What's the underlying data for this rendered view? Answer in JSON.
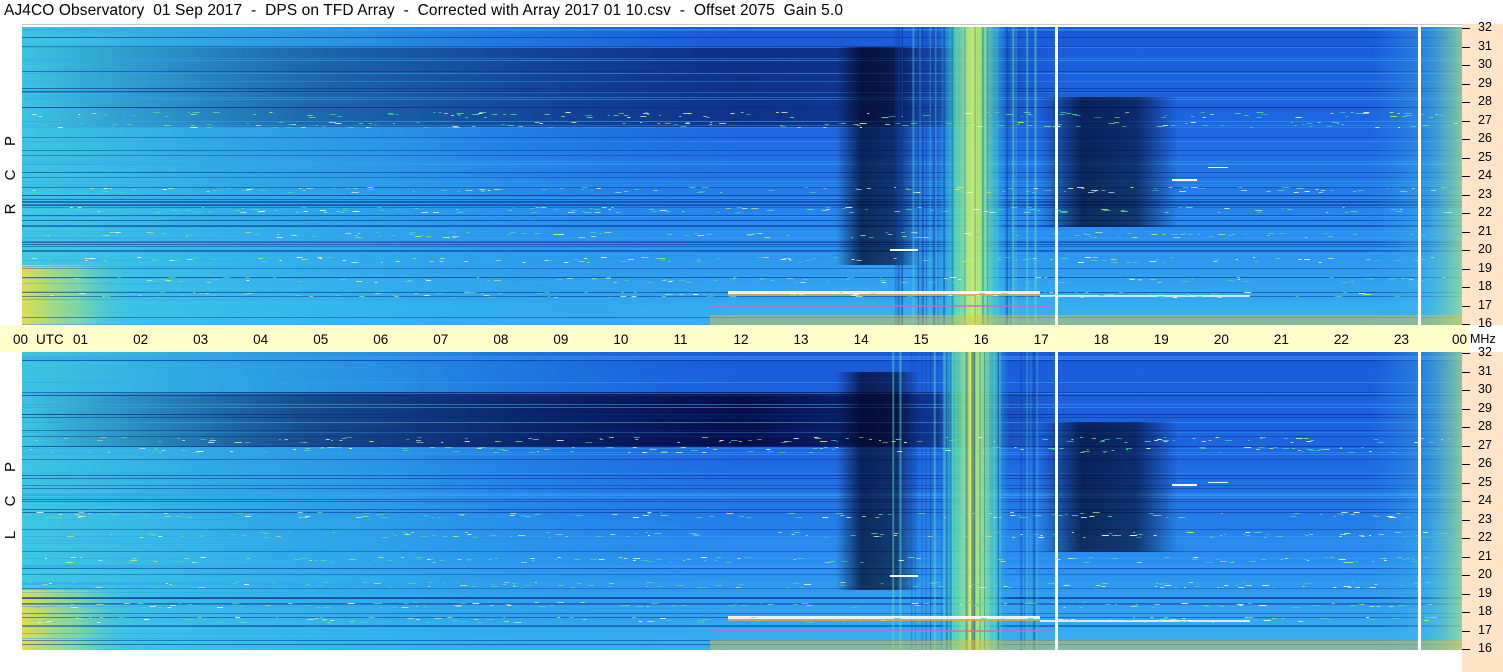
{
  "title": "AJ4CO Observatory  01 Sep 2017  -  DPS on TFD Array  -  Corrected with Array 2017 01 10.csv  -  Offset 2075  Gain 5.0",
  "time_axis": {
    "utc_label": "UTC",
    "hours": [
      "00",
      "01",
      "02",
      "03",
      "04",
      "05",
      "06",
      "07",
      "08",
      "09",
      "10",
      "11",
      "12",
      "13",
      "14",
      "15",
      "16",
      "17",
      "18",
      "19",
      "20",
      "21",
      "22",
      "23",
      "00"
    ]
  },
  "freq_axis": {
    "unit": "MHz",
    "ticks": [
      "32",
      "31",
      "30",
      "29",
      "28",
      "27",
      "26",
      "25",
      "24",
      "23",
      "22",
      "21",
      "20",
      "19",
      "18",
      "17",
      "16"
    ]
  },
  "panels": [
    {
      "id": "rcp",
      "polarization": [
        "P",
        "C",
        "R"
      ]
    },
    {
      "id": "lcp",
      "polarization": [
        "P",
        "C",
        "L"
      ]
    }
  ],
  "colors": {
    "time_axis_bg": "#ffffcc",
    "freq_axis_bg": "#ffe4c8",
    "deep_blue": "#0a1a6a",
    "mid_blue": "#1a5ad8",
    "cyan": "#20b0f0",
    "green": "#60e0a0",
    "yellow": "#e8f050"
  }
}
